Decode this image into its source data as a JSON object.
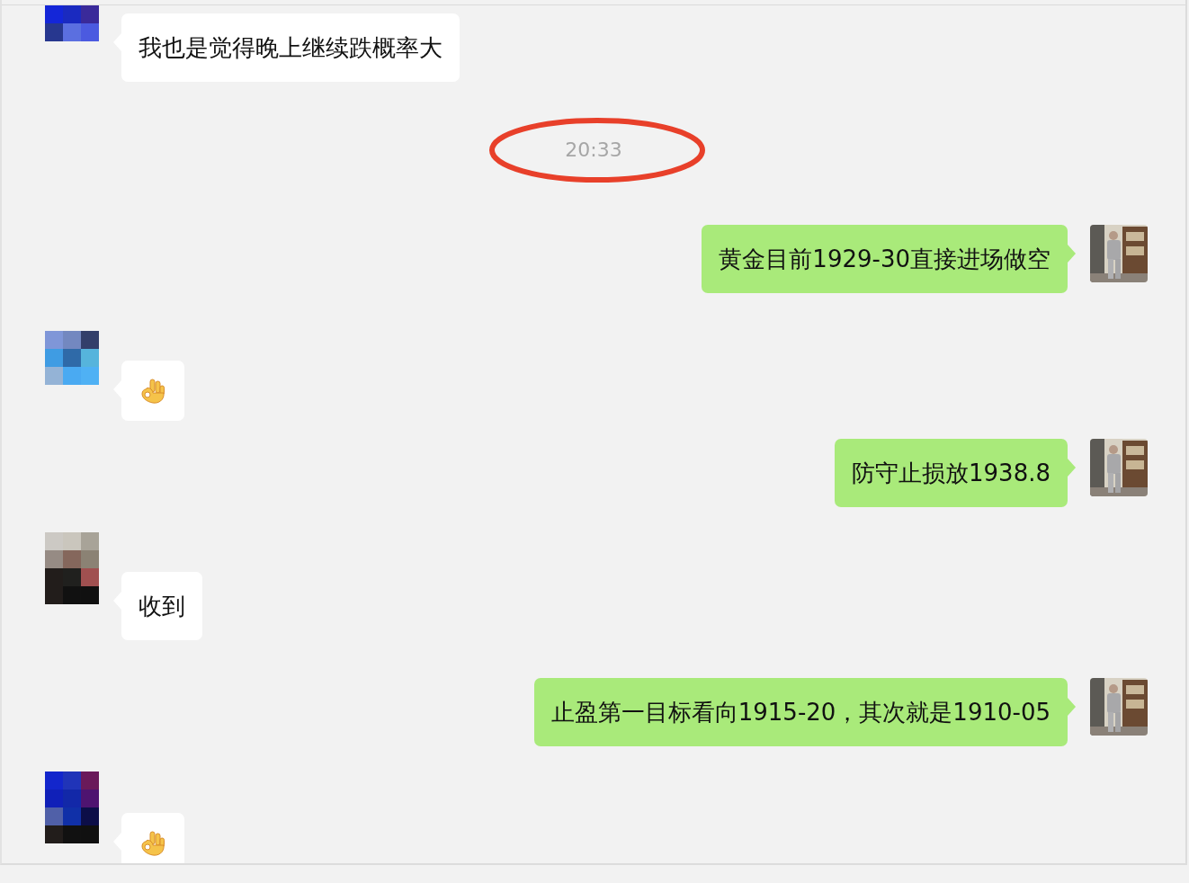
{
  "messages": [
    {
      "kind": "text",
      "outgoing": false,
      "text": "我也是觉得晚上继续跌概率大"
    },
    {
      "kind": "time",
      "text": "20:33",
      "circled": true
    },
    {
      "kind": "text",
      "outgoing": true,
      "text": "黄金目前1929-30直接进场做空"
    },
    {
      "kind": "emoji",
      "outgoing": false
    },
    {
      "kind": "text",
      "outgoing": true,
      "text": "防守止损放1938.8"
    },
    {
      "kind": "text",
      "outgoing": false,
      "text": "收到"
    },
    {
      "kind": "text",
      "outgoing": true,
      "text": "止盈第一目标看向1915-20，其次就是1910-05"
    },
    {
      "kind": "emoji",
      "outgoing": false
    }
  ]
}
